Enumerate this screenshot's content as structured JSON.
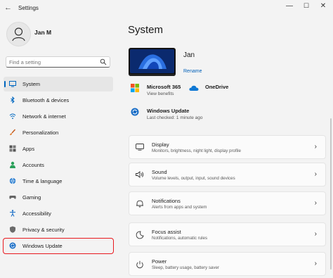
{
  "window": {
    "title": "Settings",
    "back_glyph": "←",
    "minimize_glyph": "—",
    "maximize_glyph": "☐",
    "close_glyph": "✕"
  },
  "profile": {
    "name": "Jan M"
  },
  "search": {
    "placeholder": "Find a setting",
    "icon": "search-icon"
  },
  "sidebar": {
    "items": [
      {
        "label": "System",
        "icon": "system-icon",
        "selected": true
      },
      {
        "label": "Bluetooth & devices",
        "icon": "bluetooth-icon"
      },
      {
        "label": "Network & internet",
        "icon": "network-icon"
      },
      {
        "label": "Personalization",
        "icon": "brush-icon"
      },
      {
        "label": "Apps",
        "icon": "apps-icon"
      },
      {
        "label": "Accounts",
        "icon": "accounts-icon"
      },
      {
        "label": "Time & language",
        "icon": "globe-icon"
      },
      {
        "label": "Gaming",
        "icon": "gaming-icon"
      },
      {
        "label": "Accessibility",
        "icon": "accessibility-icon"
      },
      {
        "label": "Privacy & security",
        "icon": "shield-icon"
      },
      {
        "label": "Windows Update",
        "icon": "update-icon",
        "highlighted": true
      }
    ]
  },
  "main": {
    "title": "System",
    "device": {
      "name": "Jan",
      "rename_label": "Rename"
    },
    "services": [
      {
        "title": "Microsoft 365",
        "subtitle": "View benefits",
        "icon": "microsoft-logo-icon"
      },
      {
        "title": "OneDrive",
        "subtitle": "",
        "icon": "onedrive-icon"
      },
      {
        "title": "Windows Update",
        "subtitle": "Last checked: 1 minute ago",
        "icon": "update-icon"
      }
    ],
    "cards": [
      {
        "title": "Display",
        "subtitle": "Monitors, brightness, night light, display profile",
        "icon": "display-icon"
      },
      {
        "title": "Sound",
        "subtitle": "Volume levels, output, input, sound devices",
        "icon": "sound-icon"
      },
      {
        "title": "Notifications",
        "subtitle": "Alerts from apps and system",
        "icon": "bell-icon"
      },
      {
        "title": "Focus assist",
        "subtitle": "Notifications, automatic rules",
        "icon": "focus-icon"
      },
      {
        "title": "Power",
        "subtitle": "Sleep, battery usage, battery saver",
        "icon": "power-icon"
      }
    ],
    "chevron_glyph": "›"
  },
  "colors": {
    "accent": "#0067c0",
    "highlight_border": "#e8181e",
    "background": "#f3f3f3"
  }
}
